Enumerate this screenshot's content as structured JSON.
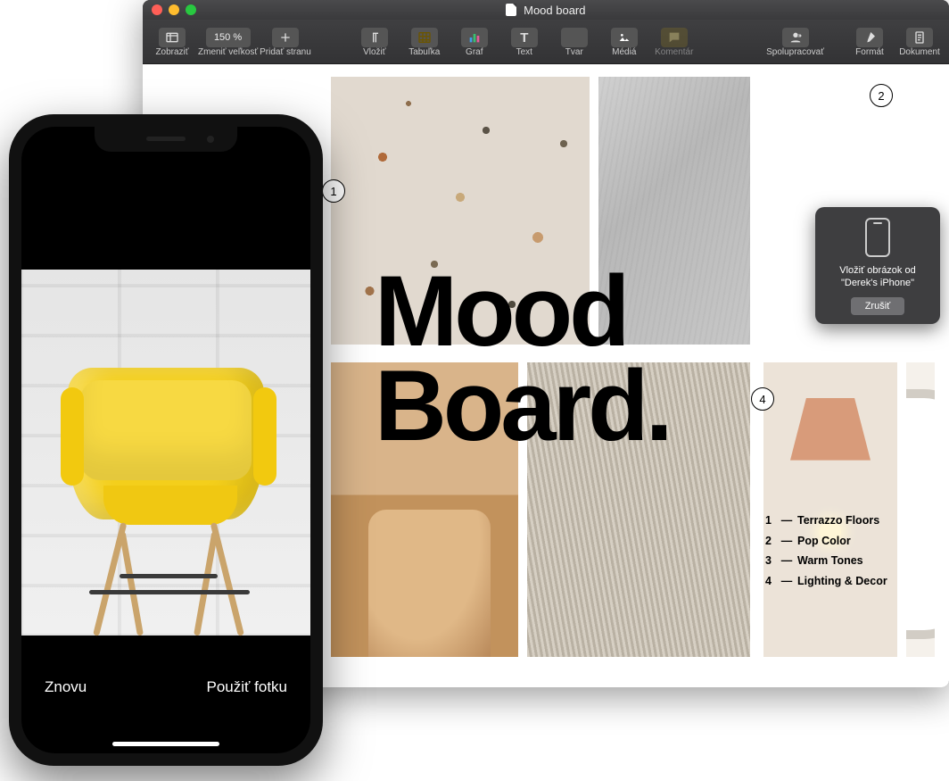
{
  "window": {
    "title": "Mood board"
  },
  "toolbar": {
    "view": "Zobraziť",
    "zoom": "150 %",
    "zoom_label": "Zmeniť veľkosť",
    "add_page": "Pridať stranu",
    "insert": "Vložiť",
    "table": "Tabuľka",
    "chart": "Graf",
    "text": "Text",
    "shape": "Tvar",
    "media": "Médiá",
    "comment": "Komentár",
    "collaborate": "Spolupracovať",
    "format": "Formát",
    "document": "Dokument"
  },
  "doc": {
    "big_title_line1": "Mood",
    "big_title_line2": "Board.",
    "callouts": {
      "c1": "1",
      "c2": "2",
      "c4": "4"
    },
    "legend": [
      {
        "n": "1",
        "label": "Terrazzo Floors"
      },
      {
        "n": "2",
        "label": "Pop Color"
      },
      {
        "n": "3",
        "label": "Warm Tones"
      },
      {
        "n": "4",
        "label": "Lighting & Decor"
      }
    ]
  },
  "popover": {
    "line1": "Vložiť obrázok od",
    "line2": "\"Derek's iPhone\"",
    "cancel": "Zrušiť"
  },
  "iphone": {
    "retake": "Znovu",
    "use": "Použiť fotku"
  }
}
